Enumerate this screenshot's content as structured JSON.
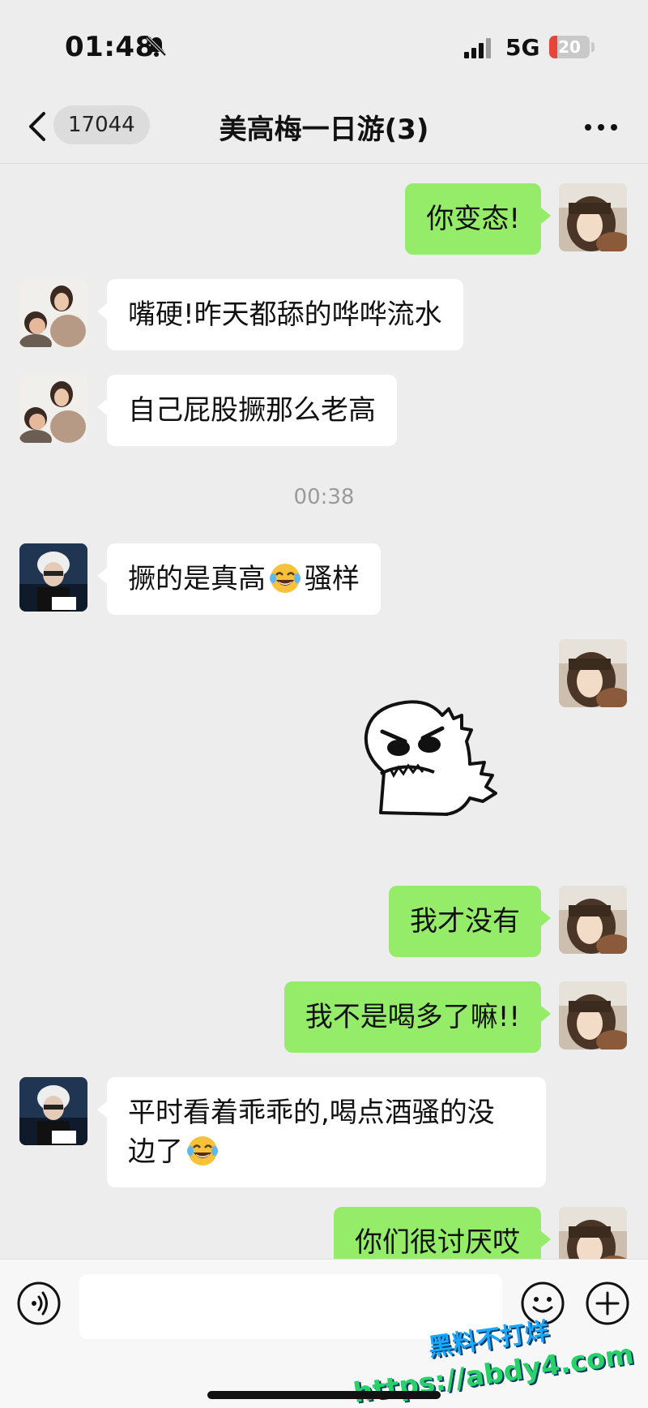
{
  "status_bar": {
    "time": "01:48",
    "network": "5G",
    "battery": "20",
    "battery_level": 0.2,
    "battery_color": "#e5453a"
  },
  "nav": {
    "unread_count": "17044",
    "title": "美高梅一日游(3)"
  },
  "colors": {
    "outgoing_bubble": "#95ec69",
    "incoming_bubble": "#ffffff",
    "background": "#ededed"
  },
  "messages": [
    {
      "side": "out",
      "text": "你变态!"
    },
    {
      "side": "in",
      "sender": "family-avatar",
      "text": "嘴硬!昨天都舔的哗哗流水"
    },
    {
      "side": "in",
      "sender": "family-avatar",
      "text": "自己屁股撅那么老高"
    },
    {
      "type": "time",
      "text": "00:38"
    },
    {
      "side": "in",
      "sender": "whitehair-avatar",
      "text": "撅的是真高",
      "emoji": "tears-of-joy",
      "text_after": "骚样"
    },
    {
      "side": "out",
      "type": "sticker",
      "sticker": "angry-dinosaur"
    },
    {
      "side": "out",
      "text": "我才没有"
    },
    {
      "side": "out",
      "text": "我不是喝多了嘛!!"
    },
    {
      "side": "in",
      "sender": "whitehair-avatar",
      "text_line1": "平时看着乖乖的,喝点酒骚的没",
      "text_line2": "边了",
      "emoji": "tears-of-joy"
    },
    {
      "side": "out",
      "text": "你们很讨厌哎"
    }
  ],
  "watermark": {
    "line1": "黑料不打烊",
    "line2": "https://abdy4.com"
  },
  "input": {
    "placeholder": ""
  }
}
